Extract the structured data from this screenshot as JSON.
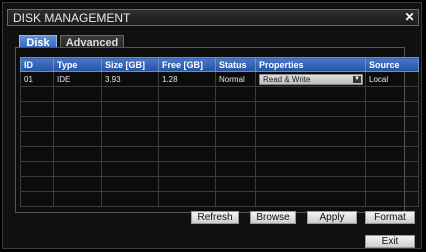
{
  "window": {
    "title": "DISK MANAGEMENT",
    "close_glyph": "✕"
  },
  "tabs": [
    {
      "label": "Disk",
      "active": true
    },
    {
      "label": "Advanced",
      "active": false
    }
  ],
  "table": {
    "columns": [
      "ID",
      "Type",
      "Size [GB]",
      "Free [GB]",
      "Status",
      "Properties",
      "Source"
    ],
    "rows": [
      {
        "id": "01",
        "type": "IDE",
        "size": "3.93",
        "free": "1.28",
        "status": "Normal",
        "properties": "Read & Write",
        "source": "Local"
      }
    ],
    "empty_row_count": 8
  },
  "buttons": {
    "refresh": "Refresh",
    "browse": "Browse",
    "apply": "Apply",
    "format": "Format",
    "exit": "Exit"
  },
  "icons": {
    "close": "close-icon",
    "dropdown": "chevron-down-icon"
  },
  "colors": {
    "header_blue": "#2f5fb3",
    "tab_blue": "#3d72c8",
    "background": "#0c0c0c"
  }
}
